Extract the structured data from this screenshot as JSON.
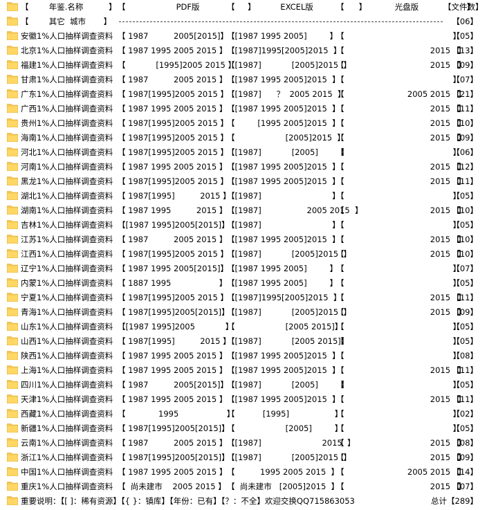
{
  "header": {
    "name_col": "【        年鉴.名称          】",
    "pdf_col": "【                    PDF版                   】",
    "excel_col": "【                  EXCEL版                  】",
    "cd_col": "【                    光盘版                   】",
    "count_col": "【文件数】"
  },
  "other_row": {
    "label": "【        其它  城市       】",
    "count": "【06】"
  },
  "rows": [
    {
      "name": "安徽1%人口抽样调查资料",
      "pdf": "【 1987          2005[2015]】",
      "excel": "【[1987 1995 2005]         】",
      "cd": "【                                           】",
      "count": "【05】"
    },
    {
      "name": "北京1%人口抽样调查资料",
      "pdf": "【 1987 1995 2005 2015 】",
      "excel": "【[1987]1995[2005]2015  】",
      "cd": "【                                  2015   】",
      "count": "【13】"
    },
    {
      "name": "福建1%人口抽样调查资料",
      "pdf": "【            [1995]2005 2015 】",
      "excel": "【[1987]            [2005]2015  】",
      "cd": "【                                  2015   】",
      "count": "【09】"
    },
    {
      "name": "甘肃1%人口抽样调查资料",
      "pdf": "【 1987          2005 2015 】",
      "excel": "【[1987 1995 2005]2015  】",
      "cd": "【                                           】",
      "count": "【07】"
    },
    {
      "name": "广东1%人口抽样调查资料",
      "pdf": "【 1987[1995]2005 2015 】",
      "excel": "【[1987]      ？  2005 2015  】",
      "cd": "【                         2005 2015   】",
      "count": "【21】"
    },
    {
      "name": "广西1%人口抽样调查资料",
      "pdf": "【 1987 1995 2005 2015 】",
      "excel": "【[1987 1995 2005]2015  】",
      "cd": "【                                  2015   】",
      "count": "【11】"
    },
    {
      "name": "贵州1%人口抽样调查资料",
      "pdf": "【 1987[1995]2005 2015 】",
      "excel": "【         [1995 2005]2015  】",
      "cd": "【                                  2015   】",
      "count": "【10】"
    },
    {
      "name": "海南1%人口抽样调查资料",
      "pdf": "【 1987[1995]2005 2015 】",
      "excel": "【                    [2005]2015  】",
      "cd": "【                                  2015   】",
      "count": "【09】"
    },
    {
      "name": "河北1%人口抽样调查资料",
      "pdf": "【 1987[1995]2005 2015 】",
      "excel": "【[1987]            [2005]         】",
      "cd": "【                                           】",
      "count": "【06】"
    },
    {
      "name": "河南1%人口抽样调查资料",
      "pdf": "【 1987 1995 2005 2015 】",
      "excel": "【[1987 1995 2005]2015  】",
      "cd": "【                                  2015   】",
      "count": "【12】"
    },
    {
      "name": "黑龙1%人口抽样调查资料",
      "pdf": "【 1987[1995]2005 2015 】",
      "excel": "【[1987 1995 2005]2015  】",
      "cd": "【                                  2015   】",
      "count": "【11】"
    },
    {
      "name": "湖北1%人口抽样调查资料",
      "pdf": "【 1987[1995]          2015 】",
      "excel": "【[1987]                            】",
      "cd": "【                                           】",
      "count": "【05】"
    },
    {
      "name": "湖南1%人口抽样调查资料",
      "pdf": "【 1987 1995          2015 】",
      "excel": "【[1987]                  2005 2015  】",
      "cd": "【                                  2015   】",
      "count": "【10】"
    },
    {
      "name": "吉林1%人口抽样调查资料",
      "pdf": "【[1987 1995]2005[2015]】",
      "excel": "【[1987]                            】",
      "cd": "【                                           】",
      "count": "【05】"
    },
    {
      "name": "江苏1%人口抽样调查资料",
      "pdf": "【 1987          2005 2015 】",
      "excel": "【[1987 1995 2005]2015  】",
      "cd": "【                                  2015   】",
      "count": "【10】"
    },
    {
      "name": "江西1%人口抽样调查资料",
      "pdf": "【 1987[1995]2005 2015 】",
      "excel": "【[1987]            [2005]2015  】",
      "cd": "【                                  2015   】",
      "count": "【10】"
    },
    {
      "name": "辽宁1%人口抽样调查资料",
      "pdf": "【 1987 1995 2005[2015]】",
      "excel": "【[1987 1995 2005]         】",
      "cd": "【                                           】",
      "count": "【07】"
    },
    {
      "name": "内蒙1%人口抽样调查资料",
      "pdf": "【 1887 1995                   】",
      "excel": "【[1987 1995 2005]         】",
      "cd": "【                                           】",
      "count": "【05】"
    },
    {
      "name": "宁夏1%人口抽样调查资料",
      "pdf": "【 1987[1995]2005 2015 】",
      "excel": "【[1987]1995[2005]2015  】",
      "cd": "【                                  2015   】",
      "count": "【11】"
    },
    {
      "name": "青海1%人口抽样调查资料",
      "pdf": "【 1987[1995]2005[2015]】",
      "excel": "【[1987]            [2005]2015  】",
      "cd": "【                                  2015   】",
      "count": "【09】"
    },
    {
      "name": "山东1%人口抽样调查资料",
      "pdf": "【[1987 1995]2005            】",
      "excel": "【                    [2005 2015]】",
      "cd": "【                                           】",
      "count": "【05】"
    },
    {
      "name": "山西1%人口抽样调查资料",
      "pdf": "【 1987[1995]          2015 】",
      "excel": "【[1987]            [2005 2015]】",
      "cd": "【                                           】",
      "count": "【05】"
    },
    {
      "name": "陕西1%人口抽样调查资料",
      "pdf": "【 1987 1995 2005 2015 】",
      "excel": "【[1987 1995 2005]2015  】",
      "cd": "【                                           】",
      "count": "【08】"
    },
    {
      "name": "上海1%人口抽样调查资料",
      "pdf": "【 1987 1995 2005 2015 】",
      "excel": "【[1987 1995 2005]2015  】",
      "cd": "【                                  2015   】",
      "count": "【11】"
    },
    {
      "name": "四川1%人口抽样调查资料",
      "pdf": "【 1987          2005[2015]】",
      "excel": "【[1987]            [2005]         】",
      "cd": "【                                           】",
      "count": "【05】"
    },
    {
      "name": "天津1%人口抽样调查资料",
      "pdf": "【 1987 1995 2005 2015 】",
      "excel": "【[1987 1995 2005]2015  】",
      "cd": "【                                  2015   】",
      "count": "【11】"
    },
    {
      "name": "西藏1%人口抽样调查资料",
      "pdf": "【             1995                   】",
      "excel": "【           [1995]                  】",
      "cd": "【                                           】",
      "count": "【02】"
    },
    {
      "name": "新疆1%人口抽样调查资料",
      "pdf": "【 1987[1995]2005[2015]】",
      "excel": "【                    [2005]         】",
      "cd": "【                                           】",
      "count": "【05】"
    },
    {
      "name": "云南1%人口抽样调查资料",
      "pdf": "【 1987          2005 2015 】",
      "excel": "【[1987]                        2015  】",
      "cd": "【                                  2015   】",
      "count": "【08】"
    },
    {
      "name": "浙江1%人口抽样调查资料",
      "pdf": "【 1987[1995]2005[2015]】",
      "excel": "【[1987]            [2005]2015  】",
      "cd": "【                                  2015   】",
      "count": "【09】"
    },
    {
      "name": "中国1%人口抽样调查资料",
      "pdf": "【 1987 1995 2005 2015 】",
      "excel": "【          1995 2005 2015  】",
      "cd": "【                         2005 2015   】",
      "count": "【14】"
    },
    {
      "name": "重庆1%人口抽样调查资料",
      "pdf": "【  尚未建市    2005 2015 】",
      "excel": "【  尚未建市   [2005]2015  】",
      "cd": "【                                  2015   】",
      "count": "【07】"
    }
  ],
  "footer": {
    "note": "重要说明：【[ ]：稀有资源】【{ }：镇库】【年份：已有】【？：不全】欢迎交换QQ715863053",
    "total": "总计【289】"
  }
}
